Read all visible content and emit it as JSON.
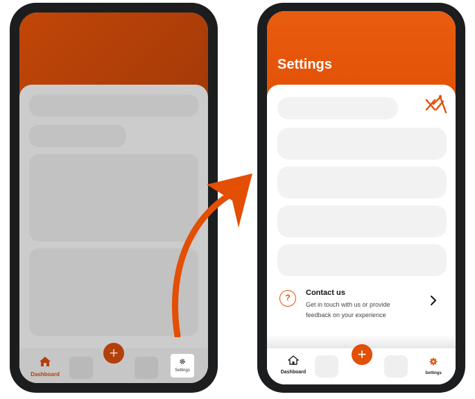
{
  "colors": {
    "accent": "#e24f05",
    "accent_dim": "#b2400a",
    "phone_frame": "#1c1d1f"
  },
  "left_screen": {
    "nav": {
      "dashboard_label": "Dashboard",
      "settings_label": "Settings",
      "add_icon": "plus-icon"
    }
  },
  "right_screen": {
    "title": "Settings",
    "contact": {
      "title": "Contact us",
      "description": "Get in touch with us or provide feedback on your experience",
      "icon": "chat-question-icon"
    },
    "nav": {
      "dashboard_label": "Dashboard",
      "settings_label": "Settings",
      "add_icon": "plus-icon"
    }
  }
}
